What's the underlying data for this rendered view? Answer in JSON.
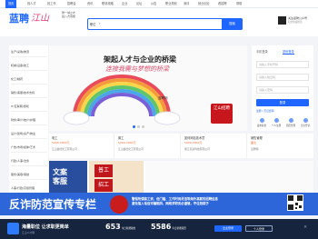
{
  "topnav": {
    "items": [
      "首页",
      "找人才",
      "找工作",
      "招聘会",
      "资讯",
      "职场攻略",
      "企业",
      "论坛",
      "公告",
      "职业规划",
      "测评",
      "就业创业",
      "看招聘",
      "帮助"
    ]
  },
  "header": {
    "logo": "蓝聘",
    "logo_script": "江山",
    "logo_sub_1": "聘一城之才",
    "logo_sub_2": "最八方贤能",
    "search_type": "职位",
    "search_button": "搜索",
    "follow_title": "关注蓝聘公众号",
    "follow_sub": "职位快速推送"
  },
  "sidebar": {
    "items": [
      "生产/采购/物流",
      "机械/设备/技工",
      "化工/制药",
      "销售/客服/技术支持",
      "IT/互联网/游戏",
      "财务/审计/统计/护理",
      "设计/建筑/房产/物业",
      "广告/市场/媒体/艺术",
      "行政/人事/法务",
      "服务/美容/保健",
      "人事/行政/高级管理",
      "教育/培训/翻译"
    ]
  },
  "banner": {
    "title": "架起人才与企业的桥梁",
    "script": "连接我需与梦想的桥梁",
    "caption": "蓝聘网",
    "seal": "江山招聘"
  },
  "login": {
    "tab_phone": "手机登录",
    "tab_password": "密码登录",
    "phone_placeholder": "请输入手机号码",
    "code_placeholder": "请输入验证码",
    "pwd_placeholder": "请输入密码",
    "login_button": "登录",
    "links": "注册 | 忘记密码",
    "quick": [
      "发布职位",
      "个人注册",
      "简历管理",
      "企业登录"
    ]
  },
  "jobs": [
    {
      "title": "电工",
      "pay": "5000-7000元",
      "company": "江山鑫旺化工有限公司"
    },
    {
      "title": "普工",
      "pay": "5000-7000元",
      "company": "江山鑫旺化工有限公司"
    },
    {
      "title": "如何网站技术员",
      "pay": "5000-7000元",
      "company": "浙江某某科技有限公司"
    },
    {
      "title": "销售管理",
      "pay": "面议",
      "company": "蓝聘网"
    }
  ],
  "promo": {
    "tile1": "文案客服",
    "tile2_a": "普工",
    "tile2_b": "招工"
  },
  "fraud": {
    "title": "反诈防范宣传专栏",
    "text_1": "警惕所谓高工资、低门槛、工作时间灵活等海外高薪的招聘信息",
    "text_2": "避免落入电信诈骗陷阱，网络求职务必谨慎，守住钱袋子"
  },
  "bottom": {
    "headline": "海量职位 让求职更简单",
    "sub": "江山人才网",
    "stat1": "653",
    "stat1_unit": "今日新增职位",
    "stat2": "5586",
    "stat2_unit": "今日新增简历",
    "btn_company": "企业登录",
    "btn_person": "个人登录"
  },
  "colors": {
    "brand": "#1f66ff",
    "bottom": "#16243d",
    "fraud": "#2c66d8",
    "accent": "#f06a2b"
  }
}
